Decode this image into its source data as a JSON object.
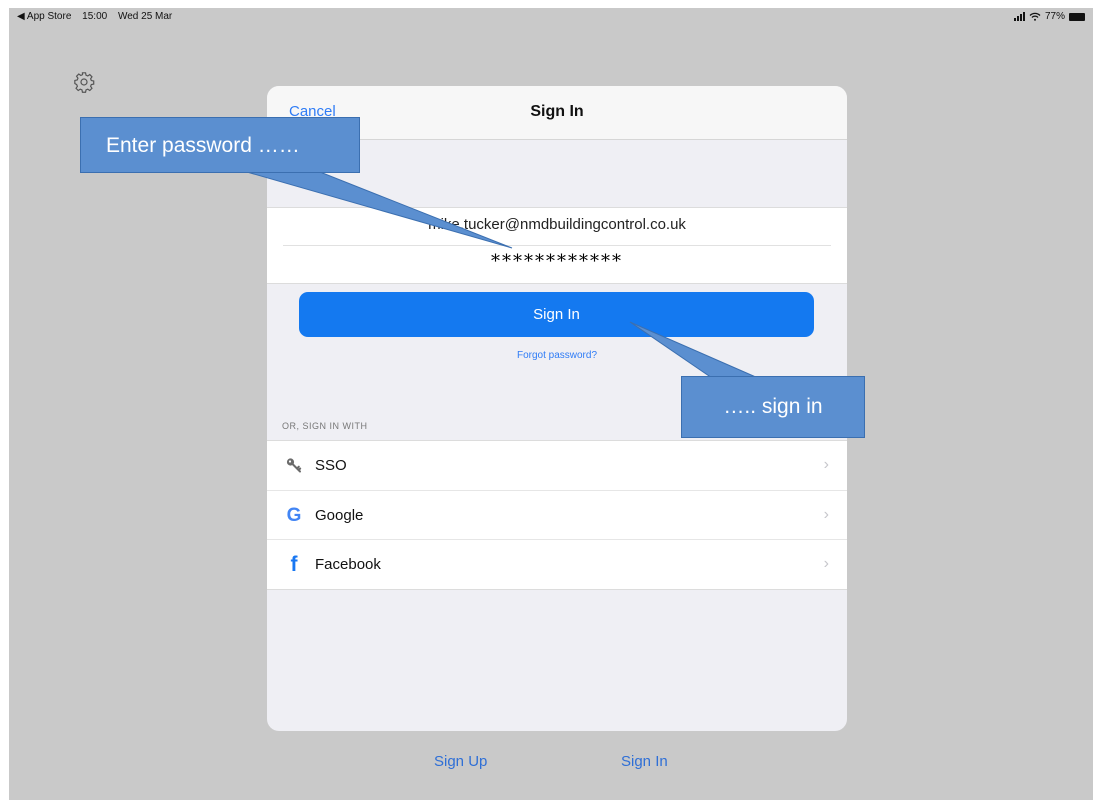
{
  "status_bar": {
    "back_app": "◀ App Store",
    "time": "15:00",
    "date": "Wed 25 Mar",
    "battery": "77%"
  },
  "icons": {
    "settings": "gear-icon",
    "sso": "key-icon",
    "google": "google-logo-icon",
    "facebook": "facebook-logo-icon",
    "chevron": "chevron-right-icon"
  },
  "modal": {
    "cancel_label": "Cancel",
    "title": "Sign In",
    "email_value": "mike.tucker@nmdbuildingcontrol.co.uk",
    "password_value": "************",
    "signin_button": "Sign In",
    "forgot_password": "Forgot password?",
    "or_label": "OR, SIGN IN WITH",
    "providers": [
      {
        "label": "SSO",
        "chevron": "›"
      },
      {
        "label": "Google",
        "chevron": "›"
      },
      {
        "label": "Facebook",
        "chevron": "›"
      }
    ]
  },
  "bottom_links": {
    "sign_up": "Sign Up",
    "sign_in": "Sign In"
  },
  "callouts": {
    "enter_password": "Enter password ……",
    "sign_in": "….. sign in"
  },
  "colors": {
    "accent": "#1479f0",
    "link": "#2f7cf6",
    "callout": "#5b8fd0",
    "backdrop": "#c9c9c9"
  }
}
